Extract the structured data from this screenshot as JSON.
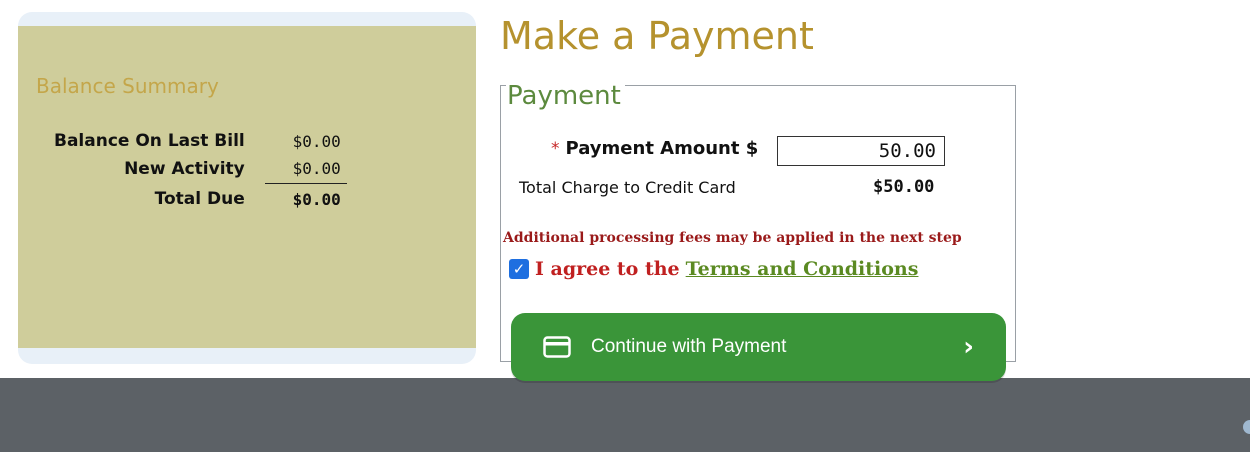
{
  "summary": {
    "title": "Balance Summary",
    "rows": [
      {
        "label": "Balance On Last Bill",
        "value": "$0.00"
      },
      {
        "label": "New Activity",
        "value": "$0.00"
      },
      {
        "label": "Total Due",
        "value": "$0.00"
      }
    ]
  },
  "payment": {
    "page_title": "Make a Payment",
    "legend": "Payment",
    "required_marker": "*",
    "amount_label": "Payment Amount $",
    "amount_value": "50.00",
    "total_charge_label": "Total Charge to Credit Card",
    "total_charge_value": "$50.00",
    "fee_note": "Additional processing fees may be applied in the next step",
    "agree_checked": true,
    "agree_text": "I agree to the",
    "terms_link": "Terms and Conditions",
    "continue_label": "Continue with Payment"
  },
  "icons": {
    "card": "credit-card-icon",
    "chevron": "chevron-right-icon"
  },
  "colors": {
    "summary_bg": "#cfcd9b",
    "title_gold": "#b5922e",
    "button_green": "#3a9539",
    "footer": "#5c6166"
  }
}
